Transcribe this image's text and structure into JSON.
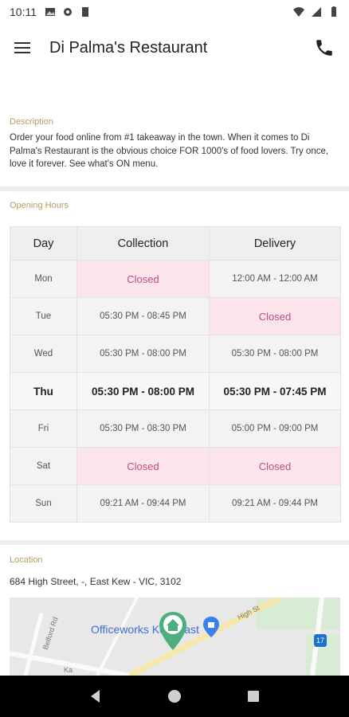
{
  "status_bar": {
    "time": "10:11"
  },
  "app_bar": {
    "title": "Di Palma's Restaurant"
  },
  "description": {
    "label": "Description",
    "text": "Order your food online from #1 takeaway in the town. When it comes to Di Palma's Restaurant is the obvious choice FOR 1000's of food lovers. Try once, love it forever. See what's ON menu."
  },
  "opening_hours": {
    "label": "Opening Hours",
    "headers": [
      "Day",
      "Collection",
      "Delivery"
    ],
    "rows": [
      {
        "day": "Mon",
        "collection": "Closed",
        "delivery": "12:00 AM - 12:00 AM"
      },
      {
        "day": "Tue",
        "collection": "05:30 PM - 08:45 PM",
        "delivery": "Closed"
      },
      {
        "day": "Wed",
        "collection": "05:30 PM - 08:00 PM",
        "delivery": "05:30 PM - 08:00 PM"
      },
      {
        "day": "Thu",
        "collection": "05:30 PM - 08:00 PM",
        "delivery": "05:30 PM - 07:45 PM"
      },
      {
        "day": "Fri",
        "collection": "05:30 PM - 08:30 PM",
        "delivery": "05:00 PM - 09:00 PM"
      },
      {
        "day": "Sat",
        "collection": "Closed",
        "delivery": "Closed"
      },
      {
        "day": "Sun",
        "collection": "09:21 AM - 09:44 PM",
        "delivery": "09:21 AM - 09:44 PM"
      }
    ]
  },
  "location": {
    "label": "Location",
    "address": "684 High Street, -, East Kew - VIC, 3102",
    "map": {
      "place_label": "Officeworks Kew East",
      "road_labels": [
        "High St",
        "Belford Rd",
        "Ka"
      ],
      "route_number": "17"
    }
  },
  "colors": {
    "accent_label": "#b59b63",
    "closed_text": "#c14a8a",
    "closed_bg": "#fbe4ea",
    "map_pin": "#4caf7d"
  },
  "icons": [
    "image-icon",
    "gear-icon",
    "sd-card-icon",
    "wifi-icon",
    "signal-icon",
    "battery-icon",
    "menu-icon",
    "phone-icon",
    "home-pin-icon",
    "shopping-pin-icon",
    "back-icon",
    "home-icon",
    "recents-icon"
  ]
}
